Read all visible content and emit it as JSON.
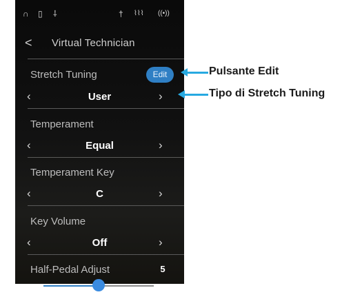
{
  "status_icons": [
    "headphones-icon",
    "usb-icon",
    "bluetooth-icon",
    "microphone-icon",
    "audio-wave-icon",
    "wireless-icon"
  ],
  "header": {
    "back_glyph": "<",
    "title": "Virtual Technician"
  },
  "rows": [
    {
      "label": "Stretch Tuning",
      "value": "User"
    },
    {
      "label": "Temperament",
      "value": "Equal"
    },
    {
      "label": "Temperament Key",
      "value": "C"
    },
    {
      "label": "Key Volume",
      "value": "Off"
    }
  ],
  "edit_button": {
    "label": "Edit"
  },
  "half_pedal": {
    "label": "Half-Pedal Adjust",
    "value": "5",
    "slider_fraction": 0.5
  },
  "callouts": [
    {
      "text": "Pulsante Edit"
    },
    {
      "text": "Tipo di Stretch Tuning"
    }
  ],
  "colors": {
    "accent": "#2f7fc4",
    "callout": "#27a9e1"
  }
}
